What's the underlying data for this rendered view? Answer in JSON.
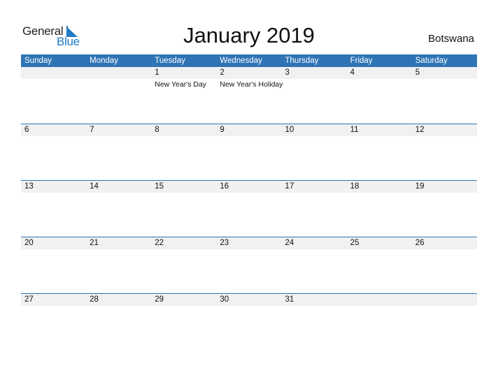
{
  "logo": {
    "line1": "General",
    "line2": "Blue",
    "icon": "triangle-flag-icon",
    "brand_color": "#1f7bc6"
  },
  "title": "January 2019",
  "country": "Botswana",
  "colors": {
    "header": "#2e74b5",
    "date_strip": "#f1f1f1"
  },
  "weekdays": [
    "Sunday",
    "Monday",
    "Tuesday",
    "Wednesday",
    "Thursday",
    "Friday",
    "Saturday"
  ],
  "weeks": [
    [
      {
        "d": "",
        "h": ""
      },
      {
        "d": "",
        "h": ""
      },
      {
        "d": "1",
        "h": "New Year's Day"
      },
      {
        "d": "2",
        "h": "New Year's Holiday"
      },
      {
        "d": "3",
        "h": ""
      },
      {
        "d": "4",
        "h": ""
      },
      {
        "d": "5",
        "h": ""
      }
    ],
    [
      {
        "d": "6",
        "h": ""
      },
      {
        "d": "7",
        "h": ""
      },
      {
        "d": "8",
        "h": ""
      },
      {
        "d": "9",
        "h": ""
      },
      {
        "d": "10",
        "h": ""
      },
      {
        "d": "11",
        "h": ""
      },
      {
        "d": "12",
        "h": ""
      }
    ],
    [
      {
        "d": "13",
        "h": ""
      },
      {
        "d": "14",
        "h": ""
      },
      {
        "d": "15",
        "h": ""
      },
      {
        "d": "16",
        "h": ""
      },
      {
        "d": "17",
        "h": ""
      },
      {
        "d": "18",
        "h": ""
      },
      {
        "d": "19",
        "h": ""
      }
    ],
    [
      {
        "d": "20",
        "h": ""
      },
      {
        "d": "21",
        "h": ""
      },
      {
        "d": "22",
        "h": ""
      },
      {
        "d": "23",
        "h": ""
      },
      {
        "d": "24",
        "h": ""
      },
      {
        "d": "25",
        "h": ""
      },
      {
        "d": "26",
        "h": ""
      }
    ],
    [
      {
        "d": "27",
        "h": ""
      },
      {
        "d": "28",
        "h": ""
      },
      {
        "d": "29",
        "h": ""
      },
      {
        "d": "30",
        "h": ""
      },
      {
        "d": "31",
        "h": ""
      },
      {
        "d": "",
        "h": ""
      },
      {
        "d": "",
        "h": ""
      }
    ]
  ]
}
